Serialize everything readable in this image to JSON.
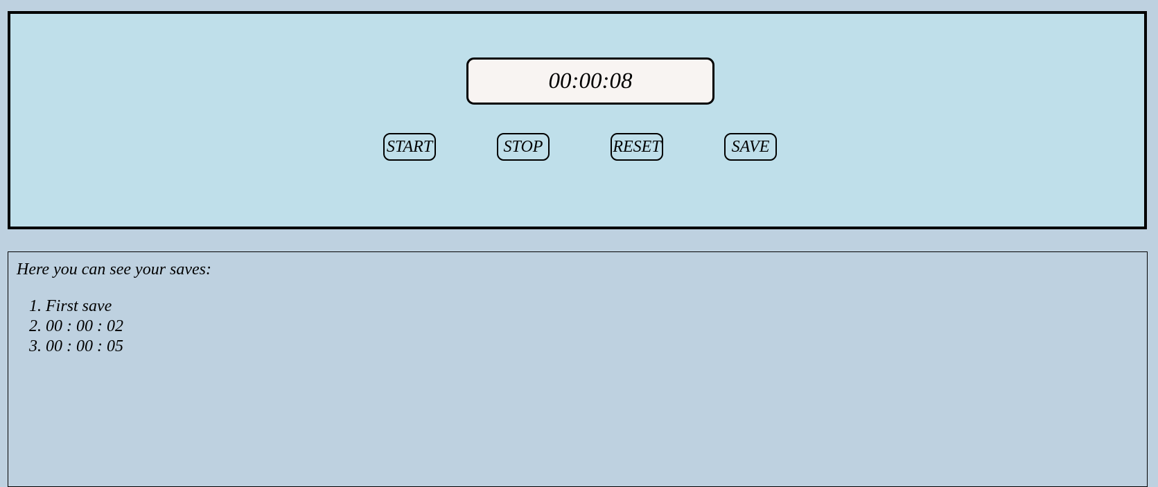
{
  "stopwatch": {
    "display": "00:00:08",
    "buttons": {
      "start": "START",
      "stop": "STOP",
      "reset": "RESET",
      "save": "SAVE"
    }
  },
  "saves": {
    "heading": "Here you can see your saves:",
    "items": [
      {
        "num": "1.",
        "text": "First save"
      },
      {
        "num": "2.",
        "text": "00 : 00 : 02"
      },
      {
        "num": "3.",
        "text": "00 : 00 : 05"
      }
    ]
  },
  "colors": {
    "page_background": "#bed1e0",
    "stopwatch_panel": "#bfdfea",
    "display_background": "#f8f4f2",
    "border": "#000000"
  }
}
